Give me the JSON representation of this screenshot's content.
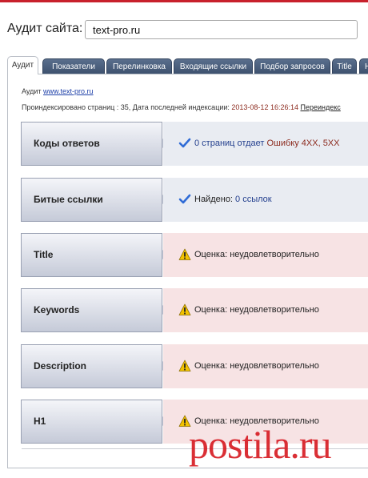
{
  "header": {
    "label": "Аудит сайта:",
    "site_value": "text-pro.ru"
  },
  "tabs": [
    {
      "label": "Аудит"
    },
    {
      "label": "Показатели"
    },
    {
      "label": "Перелинковка"
    },
    {
      "label": "Входящие ссылки"
    },
    {
      "label": "Подбор запросов"
    },
    {
      "label": "Title"
    },
    {
      "label": "H"
    }
  ],
  "crumb": {
    "prefix": "Аудит",
    "link": "www.text-pro.ru"
  },
  "index_info": {
    "text": "Проиндексировано страниц : 35, Дата последней индексации: ",
    "date": "2013-08-12 16:26:14",
    "reindex": "Переиндекс"
  },
  "rows": [
    {
      "label": "Коды ответов",
      "status": "ok",
      "icon": "checkmark-icon",
      "prefix": "",
      "number": "0 страниц отдает ",
      "suffix": "Ошибку 4XX, 5XX"
    },
    {
      "label": "Битые ссылки",
      "status": "ok",
      "icon": "checkmark-icon",
      "prefix": "Найдено: ",
      "number": "0 ссылок",
      "suffix": ""
    },
    {
      "label": "Title",
      "status": "warn",
      "icon": "warning-icon",
      "prefix": "Оценка: неудовлетворительно",
      "number": "",
      "suffix": ""
    },
    {
      "label": "Keywords",
      "status": "warn",
      "icon": "warning-icon",
      "prefix": "Оценка: неудовлетворительно",
      "number": "",
      "suffix": ""
    },
    {
      "label": "Description",
      "status": "warn",
      "icon": "warning-icon",
      "prefix": "Оценка: неудовлетворительно",
      "number": "",
      "suffix": ""
    },
    {
      "label": "H1",
      "status": "warn",
      "icon": "warning-icon",
      "prefix": "Оценка: неудовлетворительно",
      "number": "",
      "suffix": ""
    }
  ],
  "watermark": "postila.ru",
  "colors": {
    "accent": "#c8202c",
    "tab_bg": "#4a5f7d",
    "ok_bg": "#e9ecf2",
    "warn_bg": "#f7e3e4",
    "error_text": "#8c2b1f"
  }
}
